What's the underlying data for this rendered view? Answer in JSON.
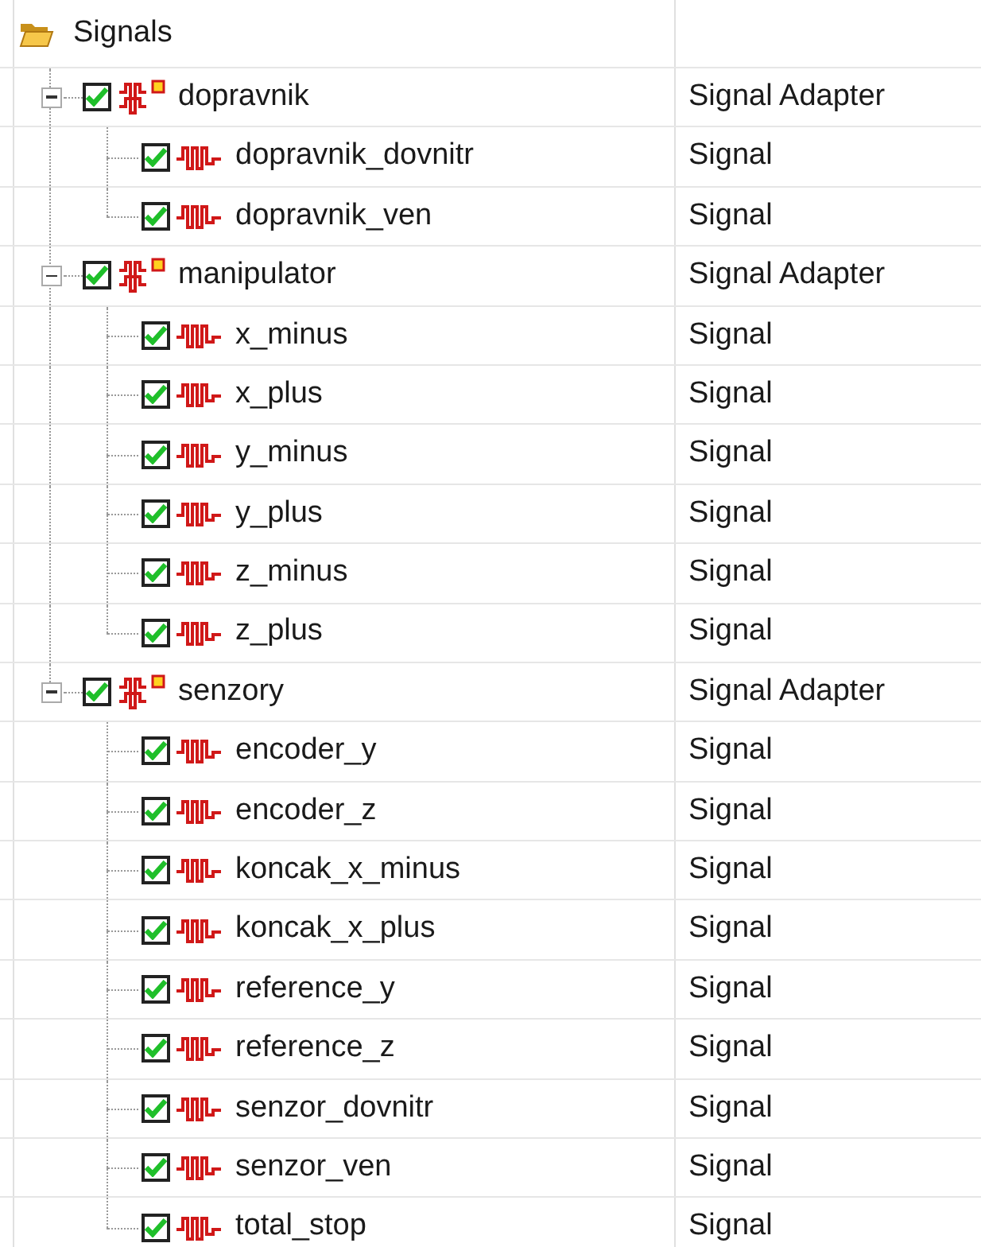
{
  "tree": {
    "label": "Signals",
    "children": [
      {
        "label": "dopravnik",
        "type": "Signal Adapter",
        "checked": true,
        "expanded": true,
        "children": [
          {
            "label": "dopravnik_dovnitr",
            "type": "Signal",
            "checked": true
          },
          {
            "label": "dopravnik_ven",
            "type": "Signal",
            "checked": true
          }
        ]
      },
      {
        "label": "manipulator",
        "type": "Signal Adapter",
        "checked": true,
        "expanded": true,
        "children": [
          {
            "label": "x_minus",
            "type": "Signal",
            "checked": true
          },
          {
            "label": "x_plus",
            "type": "Signal",
            "checked": true
          },
          {
            "label": "y_minus",
            "type": "Signal",
            "checked": true
          },
          {
            "label": "y_plus",
            "type": "Signal",
            "checked": true
          },
          {
            "label": "z_minus",
            "type": "Signal",
            "checked": true
          },
          {
            "label": "z_plus",
            "type": "Signal",
            "checked": true
          }
        ]
      },
      {
        "label": "senzory",
        "type": "Signal Adapter",
        "checked": true,
        "expanded": true,
        "children": [
          {
            "label": "encoder_y",
            "type": "Signal",
            "checked": true
          },
          {
            "label": "encoder_z",
            "type": "Signal",
            "checked": true
          },
          {
            "label": "koncak_x_minus",
            "type": "Signal",
            "checked": true
          },
          {
            "label": "koncak_x_plus",
            "type": "Signal",
            "checked": true
          },
          {
            "label": "reference_y",
            "type": "Signal",
            "checked": true
          },
          {
            "label": "reference_z",
            "type": "Signal",
            "checked": true
          },
          {
            "label": "senzor_dovnitr",
            "type": "Signal",
            "checked": true
          },
          {
            "label": "senzor_ven",
            "type": "Signal",
            "checked": true
          },
          {
            "label": "total_stop",
            "type": "Signal",
            "checked": true
          }
        ]
      }
    ]
  }
}
